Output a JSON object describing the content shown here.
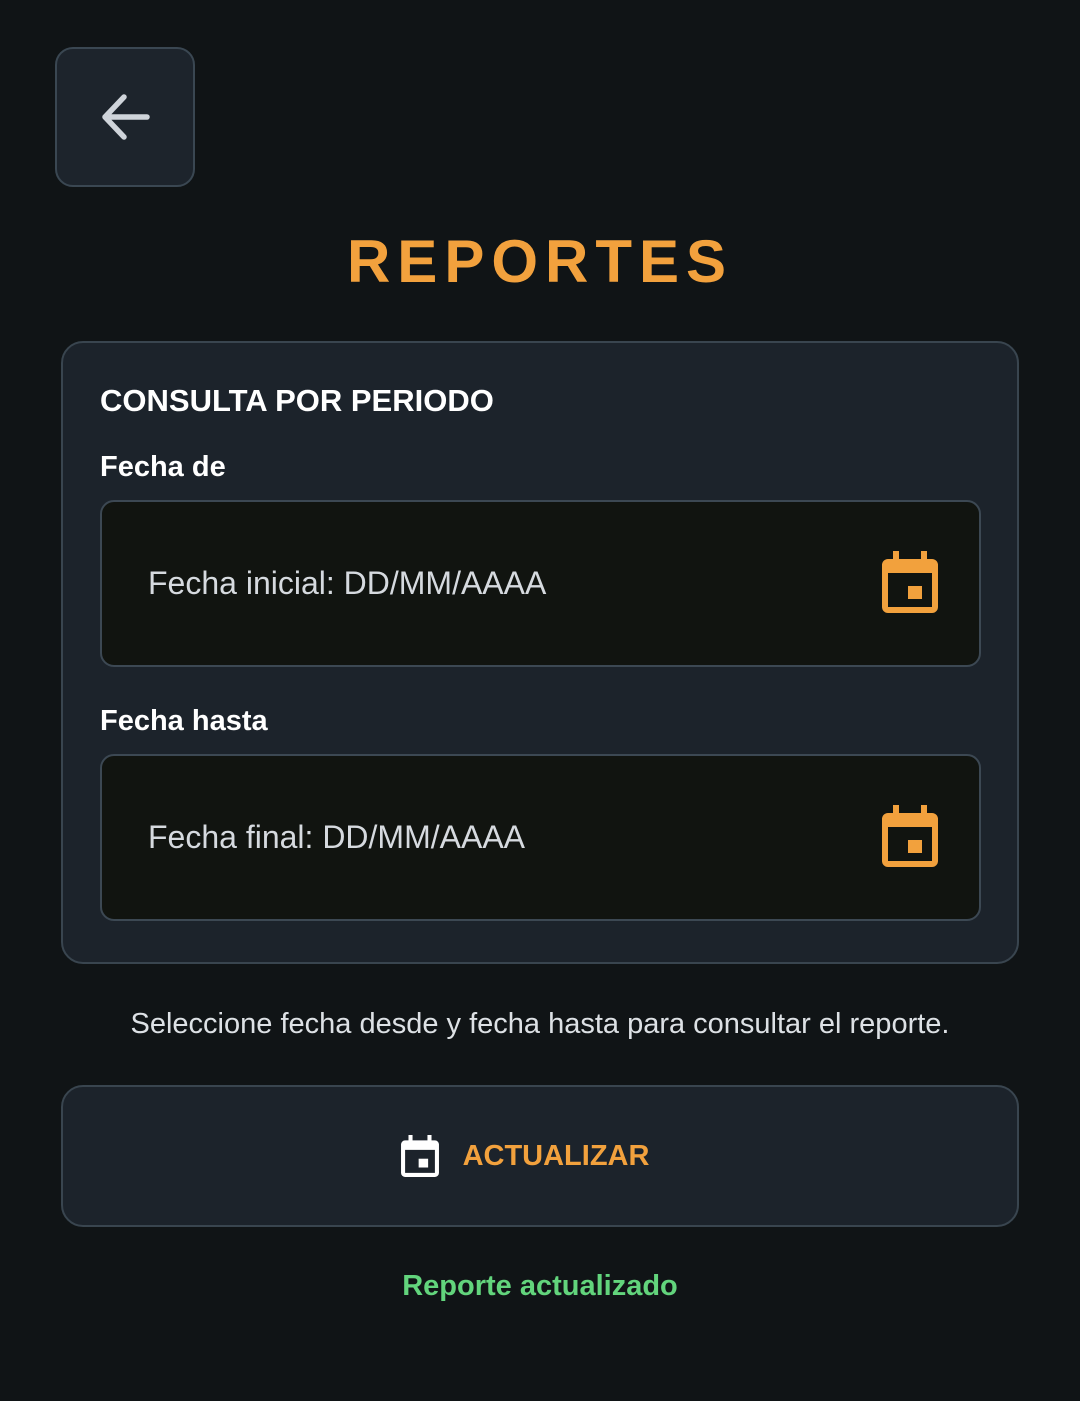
{
  "colors": {
    "accent": "#f2a13d",
    "success": "#62d47c",
    "background": "#101416",
    "card": "#1c232b",
    "field": "#111410"
  },
  "header": {
    "back_icon": "arrow-left-icon",
    "title": "REPORTES"
  },
  "period_card": {
    "title": "CONSULTA POR PERIODO",
    "from": {
      "label": "Fecha de",
      "placeholder": "Fecha inicial: DD/MM/AAAA",
      "value": "",
      "icon": "calendar-icon"
    },
    "to": {
      "label": "Fecha hasta",
      "placeholder": "Fecha final: DD/MM/AAAA",
      "value": "",
      "icon": "calendar-icon"
    }
  },
  "helper_text": "Seleccione fecha desde y fecha hasta para consultar el reporte.",
  "update_button": {
    "label": "ACTUALIZAR",
    "icon": "calendar-icon"
  },
  "status": "Reporte actualizado"
}
